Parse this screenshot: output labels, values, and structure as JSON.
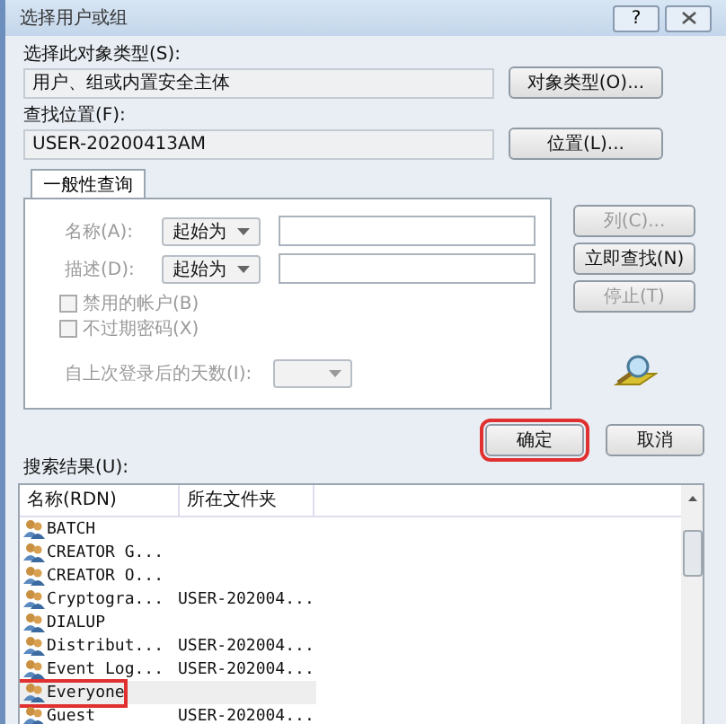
{
  "window": {
    "title": "选择用户或组",
    "help": "?"
  },
  "object_type": {
    "label": "选择此对象类型(S):",
    "value": "用户、组或内置安全主体",
    "button": "对象类型(O)..."
  },
  "location": {
    "label": "查找位置(F):",
    "value": "USER-20200413AM",
    "button": "位置(L)..."
  },
  "tabs": [
    {
      "label": "一般性查询",
      "selected": true
    }
  ],
  "query": [
    {
      "label": "名称(A):",
      "option": "起始为",
      "disabled": true
    },
    {
      "label": "描述(D):",
      "option": "起始为",
      "disabled": true
    }
  ],
  "checkboxes": [
    {
      "label": "禁用的帐户(B)",
      "checked": false,
      "disabled": true
    },
    {
      "label": "不过期密码(X)",
      "checked": false,
      "disabled": true
    }
  ],
  "days": {
    "label": "自上次登录后的天数(I):",
    "disabled": true
  },
  "side_buttons": [
    {
      "label": "列(C)...",
      "disabled": true
    },
    {
      "label": "立即查找(N)",
      "disabled": false
    },
    {
      "label": "停止(T)",
      "disabled": true
    }
  ],
  "ok_button": {
    "label": "确定",
    "highlighted": true
  },
  "cancel_button": {
    "label": "取消",
    "highlighted": false
  },
  "results": {
    "label": "搜索结果(U):",
    "columns": [
      "名称(RDN)",
      "所在文件夹"
    ],
    "rows": [
      {
        "name": "BATCH",
        "folder": "",
        "selected": false,
        "highlighted": false
      },
      {
        "name": "CREATOR G...",
        "folder": "",
        "selected": false,
        "highlighted": false
      },
      {
        "name": "CREATOR O...",
        "folder": "",
        "selected": false,
        "highlighted": false
      },
      {
        "name": "Cryptogra...",
        "folder": "USER-202004...",
        "selected": false,
        "highlighted": false
      },
      {
        "name": "DIALUP",
        "folder": "",
        "selected": false,
        "highlighted": false
      },
      {
        "name": "Distribut...",
        "folder": "USER-202004...",
        "selected": false,
        "highlighted": false
      },
      {
        "name": "Event Log...",
        "folder": "USER-202004...",
        "selected": false,
        "highlighted": false
      },
      {
        "name": "Everyone",
        "folder": "",
        "selected": true,
        "highlighted": true
      },
      {
        "name": "Guest",
        "folder": "USER-202004...",
        "selected": false,
        "highlighted": false
      }
    ]
  }
}
